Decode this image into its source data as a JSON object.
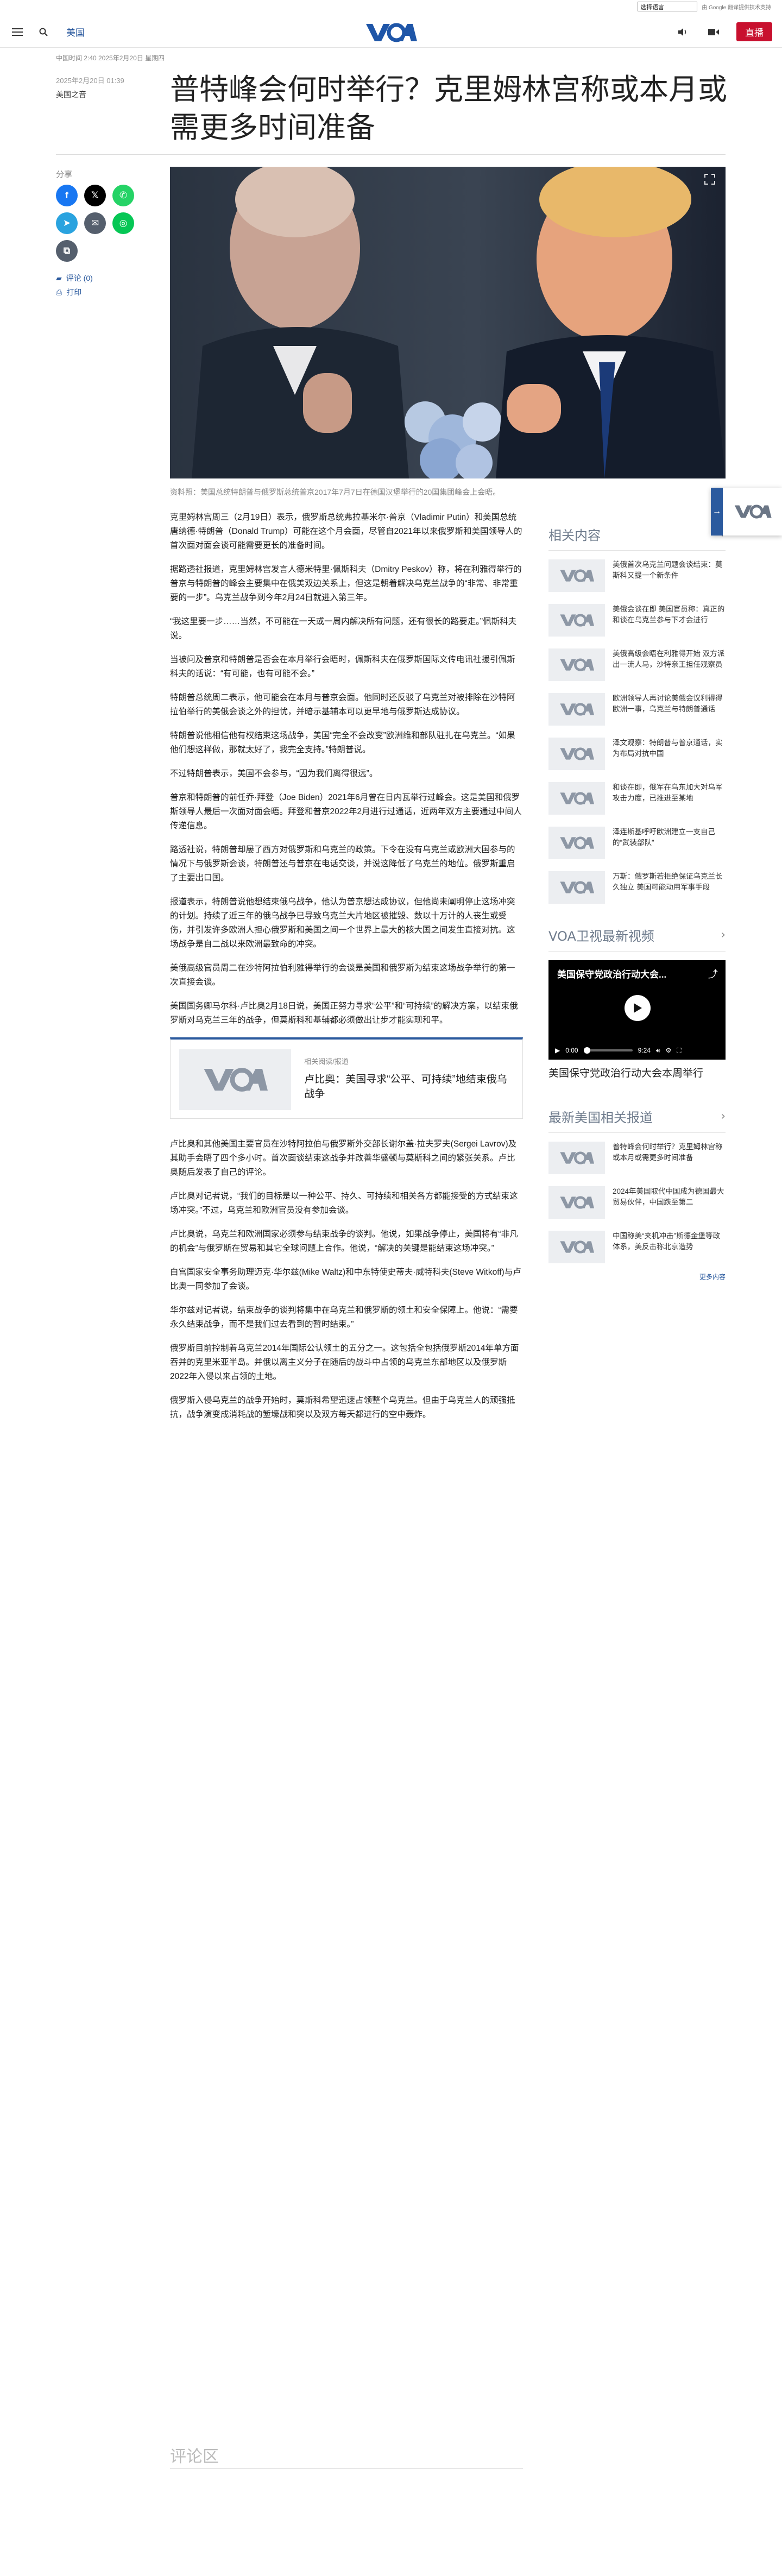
{
  "translate": {
    "select_label": "选择语言",
    "powered": "由 Google 翻译提供技术支持"
  },
  "nav": {
    "section": "美国",
    "live": "直播",
    "logo": "VOA"
  },
  "article": {
    "dateline": "中国时间 2:40 2025年2月20日 星期四",
    "date": "2025年2月20日 01:39",
    "author": "美国之音",
    "headline": "普特峰会何时举行？克里姆林宫称或本月或需更多时间准备",
    "caption": "资料照：美国总统特朗普与俄罗斯总统普京2017年7月7日在德国汉堡举行的20国集团峰会上会晤。",
    "share_label": "分享",
    "comments_link": "评论 (0)",
    "print_link": "打印",
    "paragraphs": [
      "克里姆林宫周三（2月19日）表示，俄罗斯总统弗拉基米尔·普京（Vladimir Putin）和美国总统唐纳德·特朗普（Donald Trump）可能在这个月会面，尽管自2021年以来俄罗斯和美国领导人的首次面对面会谈可能需要更长的准备时间。",
      "据路透社报道，克里姆林宫发言人德米特里·佩斯科夫（Dmitry Peskov）称，将在利雅得举行的普京与特朗普的峰会主要集中在俄美双边关系上，但这是朝着解决乌克兰战争的“非常、非常重要的一步”。乌克兰战争到今年2月24日就进入第三年。",
      "“我这里要一步……当然，不可能在一天或一周内解决所有问题，还有很长的路要走。”佩斯科夫说。",
      "当被问及普京和特朗普是否会在本月举行会晤时，佩斯科夫在俄罗斯国际文传电讯社援引佩斯科夫的话说：“有可能，也有可能不会。”",
      "特朗普总统周二表示，他可能会在本月与普京会面。他同时还反驳了乌克兰对被排除在沙特阿拉伯举行的美俄会谈之外的担忧，并暗示基辅本可以更早地与俄罗斯达成协议。",
      "特朗普说他相信他有权结束这场战争，美国“完全不会改变”欧洲维和部队驻扎在乌克兰。“如果他们想这样做，那就太好了，我完全支持。”特朗普说。",
      "不过特朗普表示，美国不会参与，“因为我们离得很远”。",
      "普京和特朗普的前任乔·拜登（Joe Biden）2021年6月曾在日内瓦举行过峰会。这是美国和俄罗斯领导人最后一次面对面会晤。拜登和普京2022年2月进行过通话，近两年双方主要通过中间人传递信息。",
      "路透社说，特朗普却屡了西方对俄罗斯和乌克兰的政策。下令在没有乌克兰或欧洲大国参与的情况下与俄罗斯会谈，特朗普还与普京在电话交谈，并说这降低了乌克兰的地位。俄罗斯重启了主要出口国。",
      "报道表示，特朗普说他想结束俄乌战争，他认为普京想达成协议，但他尚未阐明停止这场冲突的计划。持续了近三年的俄乌战争已导致乌克兰大片地区被摧毁、数以十万计的人丧生或受伤，并引发许多欧洲人担心俄罗斯和美国之间一个世界上最大的核大国之间发生直接对抗。这场战争是自二战以来欧洲最致命的冲突。",
      "美俄高级官员周二在沙特阿拉伯利雅得举行的会谈是美国和俄罗斯为结束这场战争举行的第一次直接会谈。",
      "美国国务卿马尔科·卢比奥2月18日说，美国正努力寻求“公平”和“可持续”的解决方案，以结束俄罗斯对乌克兰三年的战争，但莫斯科和基辅都必须做出让步才能实现和平。",
      "卢比奥和其他美国主要官员在沙特阿拉伯与俄罗斯外交部长谢尔盖·拉夫罗夫(Sergei Lavrov)及其助手会晤了四个多小时。首次面谈结束这战争并改善华盛顿与莫斯科之间的紧张关系。卢比奥随后发表了自己的评论。",
      "卢比奥对记者说，“我们的目标是以一种公平、持久、可持续和相关各方都能接受的方式结束这场冲突。”不过，乌克兰和欧洲官员没有参加会谈。",
      "卢比奥说，乌克兰和欧洲国家必须参与结束战争的谈判。他说，如果战争停止，美国将有“非凡的机会”与俄罗斯在贸易和其它全球问题上合作。他说，“解决的关键是能结束这场冲突。”",
      "白宫国家安全事务助理迈克·华尔兹(Mike Waltz)和中东特使史蒂夫·威特科夫(Steve Witkoff)与卢比奥一同参加了会谈。",
      "华尔兹对记者说，结束战争的谈判将集中在乌克兰和俄罗斯的领土和安全保障上。他说：“需要永久结束战争，而不是我们过去看到的暂时结束。”",
      "俄罗斯目前控制着乌克兰2014年国际公认领土的五分之一。这包括全包括俄罗斯2014年单方面吞并的克里米亚半岛。并俄以离主义分子在随后的战斗中占领的乌克兰东部地区以及俄罗斯2022年入侵以来占领的土地。",
      "俄罗斯入侵乌克兰的战争开始时，莫斯科希望迅速占领整个乌克兰。但由于乌克兰人的顽强抵抗，战争演变成消耗战的堑壕战和突以及双方每天都进行的空中轰炸。"
    ],
    "related": {
      "kicker": "相关阅读/报道",
      "title": "卢比奥：美国寻求“公平、可持续”地结束俄乌战争"
    },
    "comments_heading": "评论区"
  },
  "sidebar": {
    "related_heading": "相关内容",
    "related_items": [
      "美俄首次乌克兰问题会谈结束：莫斯科又提一个新条件",
      "美俄会谈在即 美国官员称：真正的和谈在乌克兰参与下才会进行",
      "美俄高级会晤在利雅得开始 双方派出一流人马，沙特亲王担任观察员",
      "欧洲领导人再讨论美俄会议利得得欧洲一事，乌克兰与特朗普通话",
      "泽文观察：特朗普与普京通话，实为布局对抗中国",
      "和谈在即，俄军在乌东加大对乌军攻击力度，已推进至某地",
      "泽连斯基呼吁欧洲建立一支自己的“武装部队”",
      "万斯：俄罗斯若拒绝保证乌克兰长久独立 美国可能动用军事手段"
    ],
    "video_heading": "VOA卫视最新视频",
    "video": {
      "title": "美国保守党政治行动大会...",
      "current": "0:00",
      "duration": "9:24",
      "caption": "美国保守党政治行动大会本周举行"
    },
    "latest_heading": "最新美国相关报道",
    "latest_items": [
      "普特峰会何时举行？克里姆林宫称或本月或需更多时间准备",
      "2024年美国取代中国成为德国最大贸易伙伴，中国跌至第二",
      "中国称美“夹机冲击”斯德金堡等政体系，美反击称北京造势"
    ],
    "more_link": "更多内容"
  },
  "float_tab": {
    "logo": "VOA"
  },
  "colors": {
    "brand": "#2b5a9e",
    "live": "#c8102e"
  }
}
